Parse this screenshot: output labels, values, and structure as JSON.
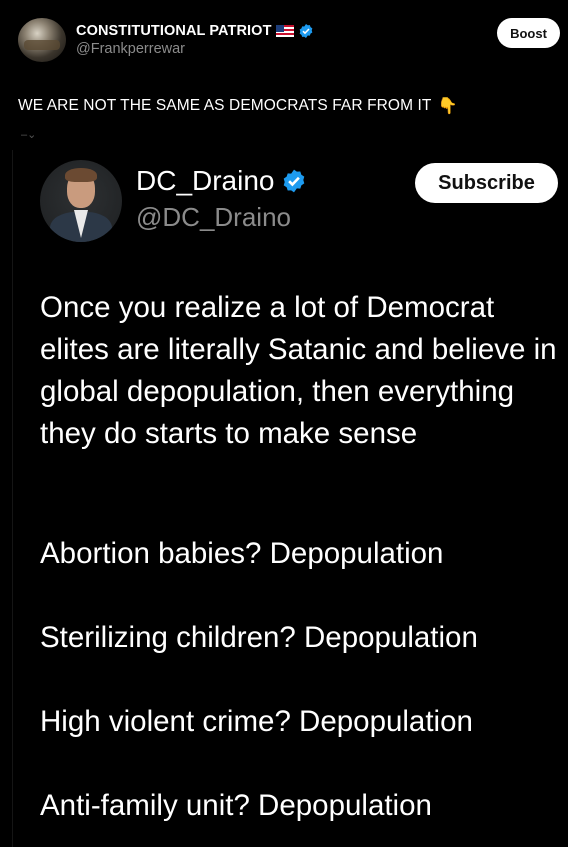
{
  "outer_post": {
    "author_name": "CONSTITUTIONAL PATRIOT",
    "handle": "@Frankperrewar",
    "boost_label": "Boost",
    "text": "WE ARE NOT THE SAME AS DEMOCRATS FAR FROM IT",
    "emoji": "👇"
  },
  "quoted_post": {
    "author_name": "DC_Draino",
    "handle": "@DC_Draino",
    "subscribe_label": "Subscribe",
    "body": "Once you realize a lot of Democrat elites are literally Satanic and believe in global depopulation, then everything they do starts to make sense",
    "lines": [
      "Abortion babies? Depopulation",
      "Sterilizing children? Depopulation",
      "High violent crime? Depopulation",
      "Anti-family unit? Depopulation"
    ]
  },
  "colors": {
    "background": "#000000",
    "verified": "#1d9bf0",
    "muted_text": "#8b8b8b"
  }
}
